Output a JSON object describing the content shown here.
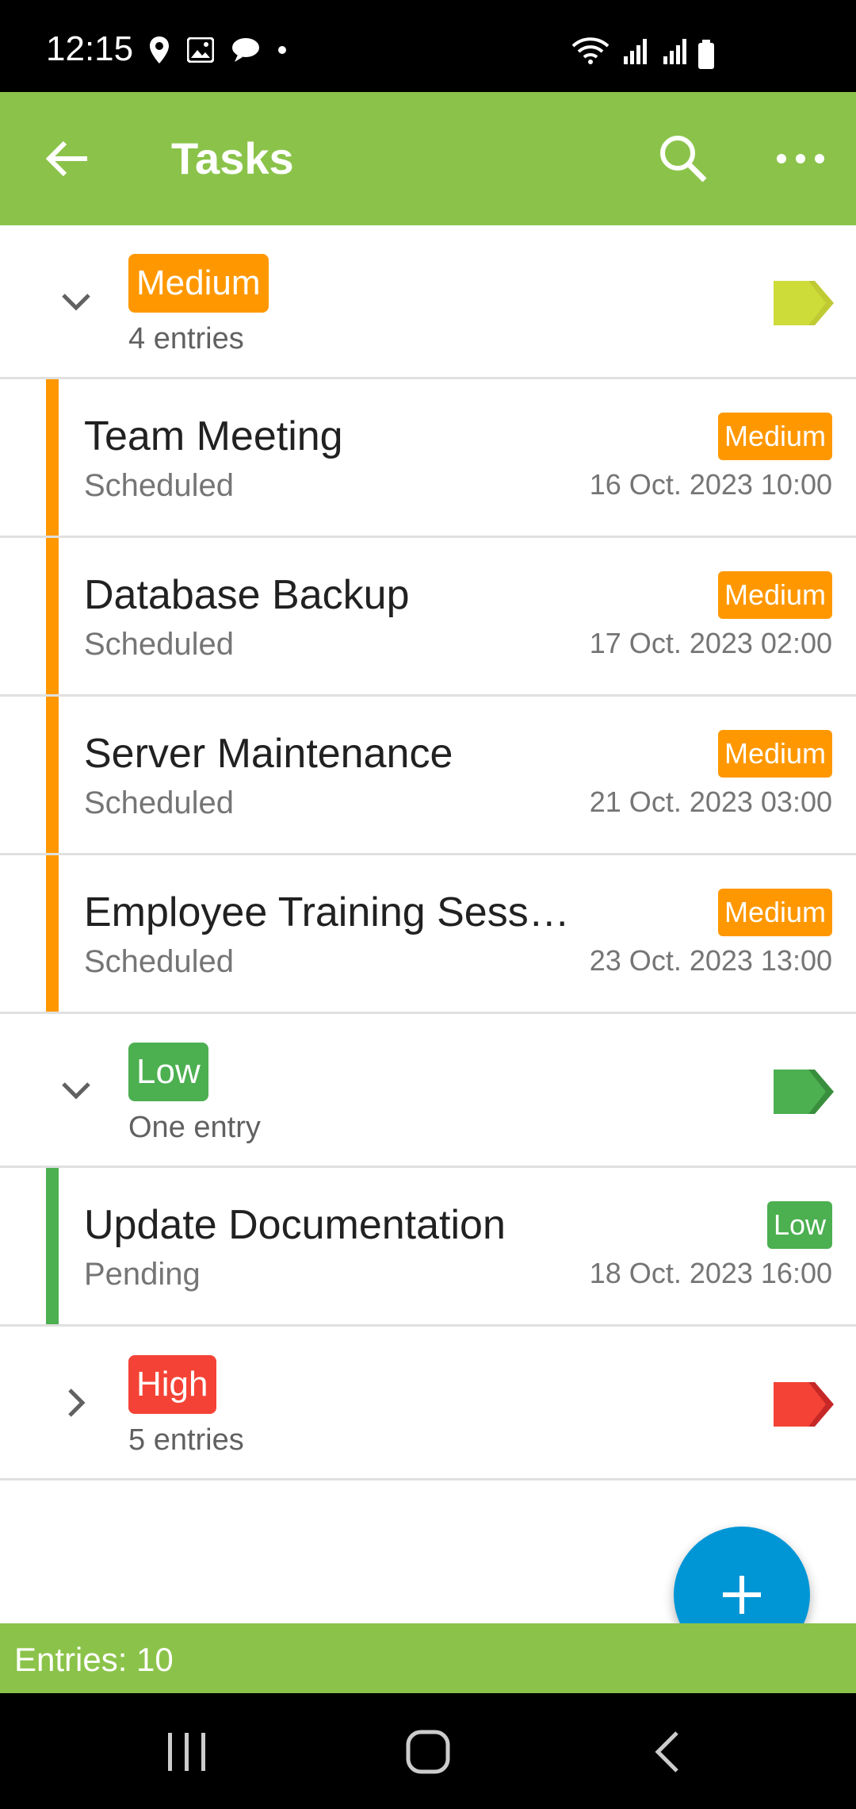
{
  "status_bar": {
    "time": "12:15"
  },
  "app_bar": {
    "title": "Tasks"
  },
  "colors": {
    "green": "#8bc34a",
    "medium": "#ff9800",
    "low": "#4caf50",
    "high": "#f44336",
    "fab": "#0096d6"
  },
  "groups": [
    {
      "label": "Medium",
      "count": "4 entries",
      "color": "#ff9800",
      "tag_color": "#cddc39",
      "expanded": true
    },
    {
      "label": "Low",
      "count": "One entry",
      "color": "#4caf50",
      "tag_color": "#4caf50",
      "expanded": true
    },
    {
      "label": "High",
      "count": "5 entries",
      "color": "#f44336",
      "tag_color": "#f44336",
      "expanded": false
    }
  ],
  "tasks": [
    {
      "title": "Team Meeting",
      "status": "Scheduled",
      "priority": "Medium",
      "date": "16 Oct. 2023 10:00"
    },
    {
      "title": "Database Backup",
      "status": "Scheduled",
      "priority": "Medium",
      "date": "17 Oct. 2023 02:00"
    },
    {
      "title": "Server Maintenance",
      "status": "Scheduled",
      "priority": "Medium",
      "date": "21 Oct. 2023 03:00"
    },
    {
      "title": "Employee Training Session",
      "status": "Scheduled",
      "priority": "Medium",
      "date": "23 Oct. 2023 13:00"
    },
    {
      "title": "Update Documentation",
      "status": "Pending",
      "priority": "Low",
      "date": "18 Oct. 2023 16:00"
    }
  ],
  "footer": {
    "entries": "Entries: 10"
  }
}
